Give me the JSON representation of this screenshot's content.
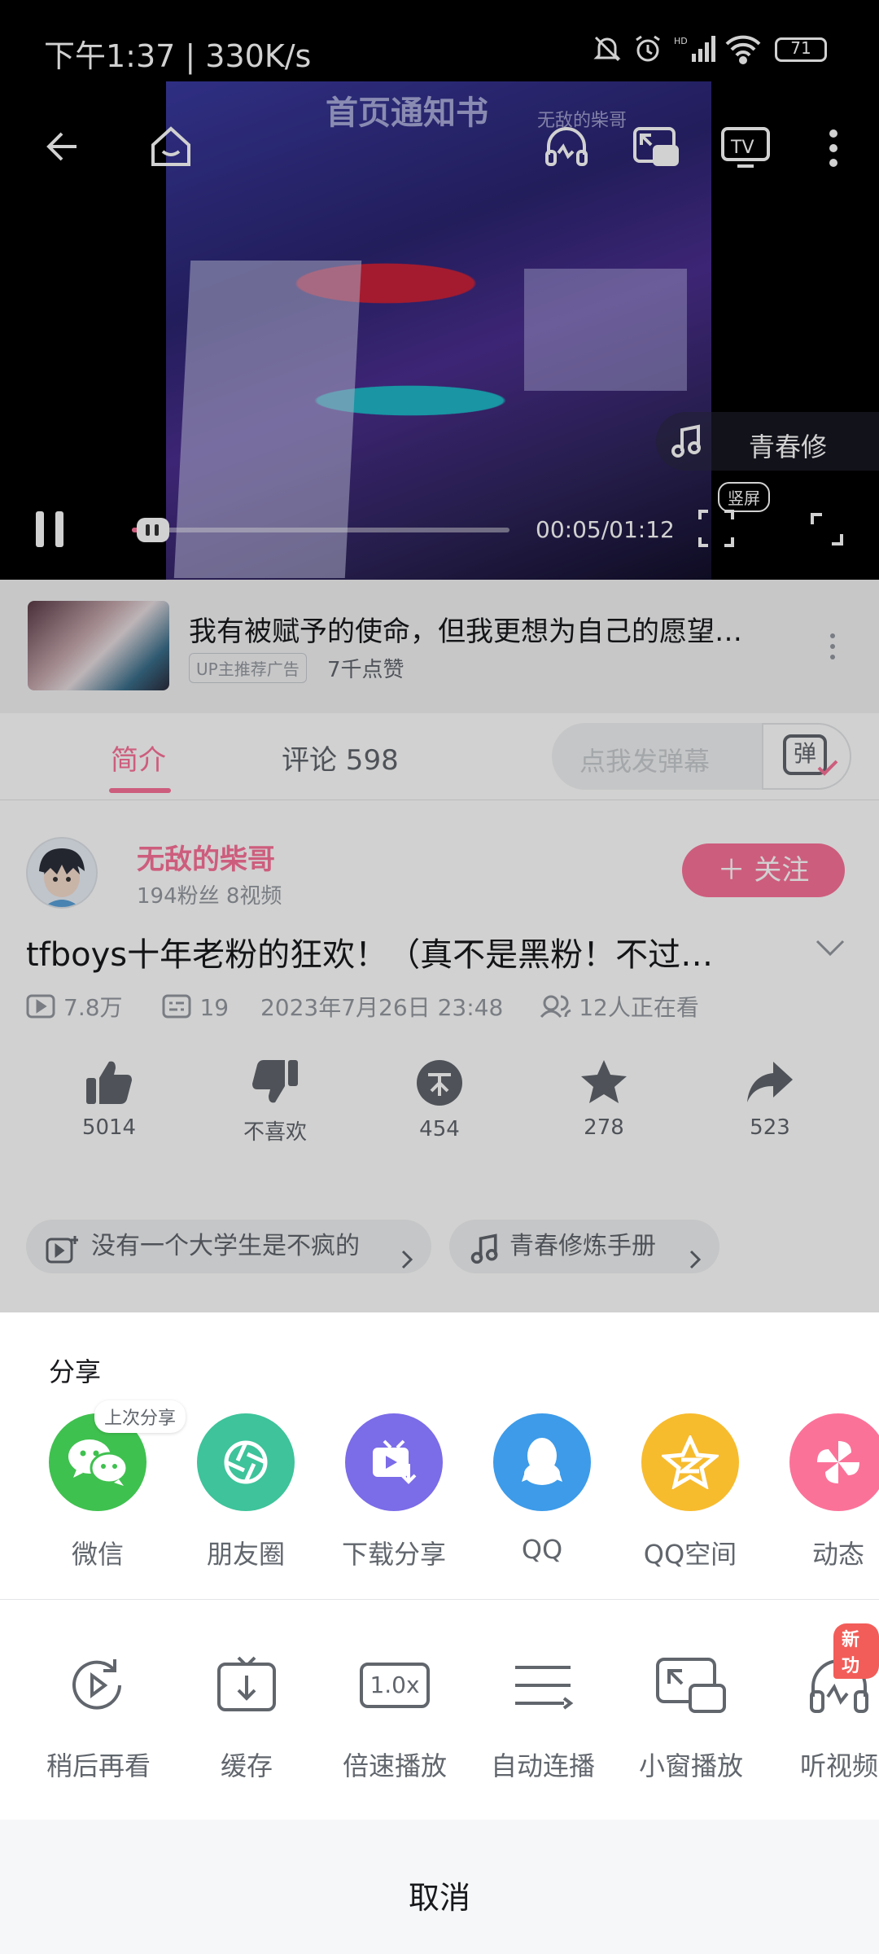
{
  "status_bar": {
    "time_speed": "下午1:37 | 330K/s",
    "battery": "71"
  },
  "video": {
    "overlay_title": "首页通知书",
    "watermark": "无敌的柴哥",
    "music_label": "青春修",
    "vertical_tag": "竖屏",
    "current_time": "00:05",
    "total_time": "01:12",
    "progress": 0.07
  },
  "ad": {
    "title": "我有被赋予的使命，但我更想为自己的愿望…",
    "badge": "UP主推荐广告",
    "likes": "7千点赞"
  },
  "tabs": {
    "intro": "简介",
    "comments": "评论 598"
  },
  "danmaku": {
    "placeholder": "点我发弹幕",
    "toggle": "弹"
  },
  "uploader": {
    "name": "无敌的柴哥",
    "stats": "194粉丝    8视频",
    "follow": "＋ 关注"
  },
  "video_info": {
    "title": "tfboys十年老粉的狂欢！（真不是黑粉！不过…",
    "views": "7.8万",
    "danmaku_count": "19",
    "date": "2023年7月26日 23:48",
    "watching": "12人正在看"
  },
  "actions": [
    {
      "icon": "thumbs-up-icon",
      "label": "5014"
    },
    {
      "icon": "thumbs-down-icon",
      "label": "不喜欢"
    },
    {
      "icon": "coin-icon",
      "label": "454"
    },
    {
      "icon": "star-icon",
      "label": "278"
    },
    {
      "icon": "share-arrow-icon",
      "label": "523"
    }
  ],
  "chips": [
    "没有一个大学生是不疯的",
    "青春修炼手册"
  ],
  "share_sheet": {
    "heading": "分享",
    "last_share": "上次分享",
    "share_targets": [
      {
        "label": "微信",
        "color": "#3fc14f"
      },
      {
        "label": "朋友圈",
        "color": "#3ec39a"
      },
      {
        "label": "下载分享",
        "color": "#7b6ce8"
      },
      {
        "label": "QQ",
        "color": "#3d9be9"
      },
      {
        "label": "QQ空间",
        "color": "#f7bb2e"
      },
      {
        "label": "动态",
        "color": "#fb7299"
      }
    ],
    "tools": [
      {
        "label": "稍后再看"
      },
      {
        "label": "缓存"
      },
      {
        "label": "倍速播放",
        "text": "1.0x"
      },
      {
        "label": "自动连播"
      },
      {
        "label": "小窗播放"
      },
      {
        "label": "听视频"
      }
    ],
    "new_badge": "新功",
    "cancel": "取消"
  },
  "colors": {
    "accent": "#fb7299",
    "text": "#18191c",
    "muted": "#61666d"
  }
}
